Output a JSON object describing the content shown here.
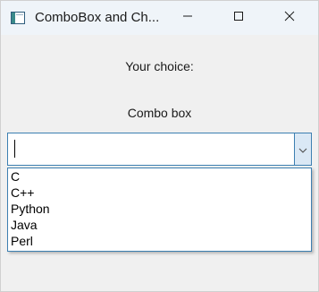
{
  "window": {
    "title": "ComboBox and Ch..."
  },
  "titlebar": {
    "app_icon": "window-app-icon",
    "minimize_icon": "minimize-icon",
    "maximize_icon": "maximize-icon",
    "close_icon": "close-icon"
  },
  "labels": {
    "choice": "Your choice:",
    "combo": "Combo box"
  },
  "combo": {
    "value": "",
    "arrow_icon": "chevron-down-icon",
    "items": [
      {
        "label": "C"
      },
      {
        "label": "C++"
      },
      {
        "label": "Python"
      },
      {
        "label": "Java"
      },
      {
        "label": "Perl"
      }
    ]
  },
  "colors": {
    "focus_border": "#3c7fb1",
    "arrow_background": "#dae8f5",
    "titlebar_background": "#eff4f9",
    "window_background": "#f0f0f0"
  }
}
